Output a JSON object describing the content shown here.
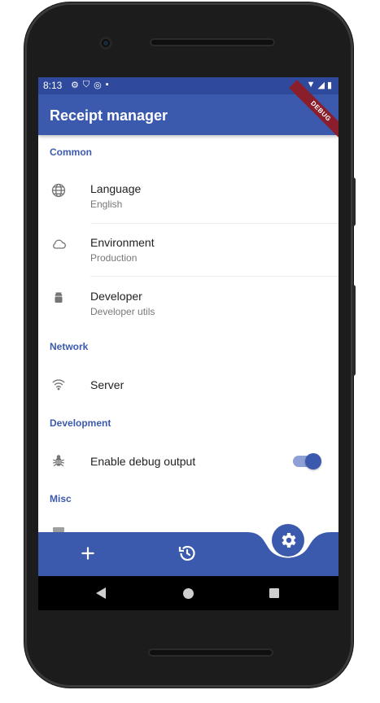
{
  "status_bar": {
    "time": "8:13",
    "left_icons": [
      "settings-icon",
      "shield-icon",
      "at-icon",
      "sd-card-icon"
    ],
    "right_icons": [
      "wifi-icon",
      "signal-icon",
      "battery-icon"
    ]
  },
  "app_bar": {
    "title": "Receipt manager",
    "debug_banner": "DEBUG"
  },
  "sections": [
    {
      "header": "Common",
      "items": [
        {
          "icon": "globe-icon",
          "title": "Language",
          "subtitle": "English"
        },
        {
          "icon": "cloud-icon",
          "title": "Environment",
          "subtitle": "Production"
        },
        {
          "icon": "android-icon",
          "title": "Developer",
          "subtitle": "Developer utils"
        }
      ]
    },
    {
      "header": "Network",
      "items": [
        {
          "icon": "wifi-icon",
          "title": "Server"
        }
      ]
    },
    {
      "header": "Development",
      "items": [
        {
          "icon": "bug-icon",
          "title": "Enable debug output",
          "toggle": true
        }
      ]
    },
    {
      "header": "Misc",
      "items": []
    }
  ],
  "bottom_bar": {
    "add_icon": "plus-icon",
    "history_icon": "history-icon",
    "fab_icon": "settings-icon"
  },
  "colors": {
    "primary": "#3c5aad",
    "status_bar": "#2f4a9c",
    "debug_banner": "#8b1e2b",
    "section_header": "#3c5aad"
  }
}
